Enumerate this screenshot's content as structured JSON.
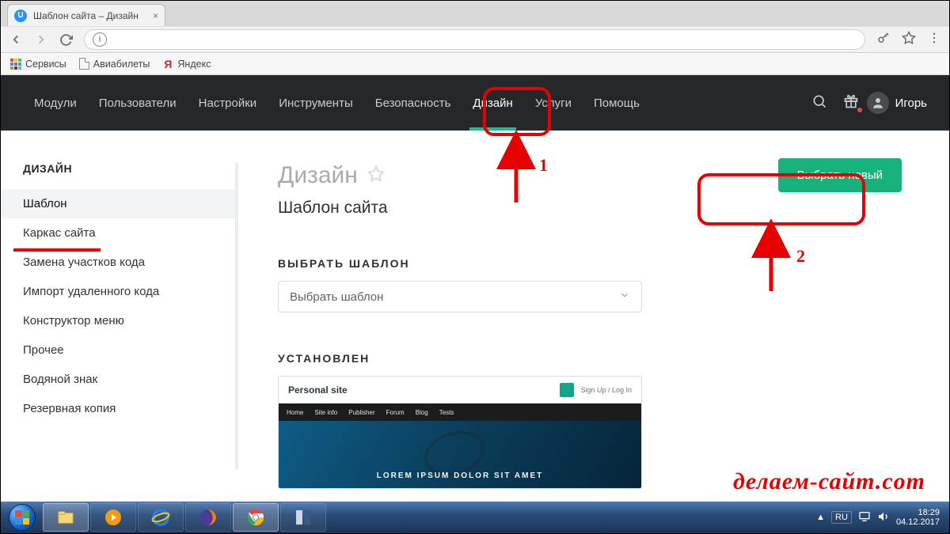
{
  "window": {
    "tab_title": "Шаблон сайта – Дизайн"
  },
  "bookmarks": {
    "apps": "Сервисы",
    "tickets": "Авиабилеты",
    "yandex": "Яндекс"
  },
  "topnav": {
    "items": [
      "Модули",
      "Пользователи",
      "Настройки",
      "Инструменты",
      "Безопасность",
      "Дизайн",
      "Услуги",
      "Помощь"
    ],
    "active_index": 5,
    "username": "Игорь"
  },
  "sidebar": {
    "title": "ДИЗАЙН",
    "items": [
      "Шаблон",
      "Каркас сайта",
      "Замена участков кода",
      "Импорт удаленного кода",
      "Конструктор меню",
      "Прочее",
      "Водяной знак",
      "Резервная копия"
    ],
    "active_index": 0
  },
  "main": {
    "title": "Дизайн",
    "subtitle": "Шаблон сайта",
    "primary_button": "Выбрать новый",
    "select_section": "ВЫБРАТЬ ШАБЛОН",
    "select_placeholder": "Выбрать шаблон",
    "installed_section": "УСТАНОВЛЕН",
    "template": {
      "name": "Personal site",
      "auth": "Sign Up / Log In",
      "menu": [
        "Home",
        "Site info",
        "Publisher",
        "Forum",
        "Blog",
        "Tests"
      ],
      "hero": "LOREM IPSUM DOLOR SIT AMET"
    }
  },
  "annotations": {
    "label1": "1",
    "label2": "2"
  },
  "watermark": "делаем-сайт.com",
  "taskbar": {
    "lang": "RU",
    "time": "18:29",
    "date": "04.12.2017"
  }
}
